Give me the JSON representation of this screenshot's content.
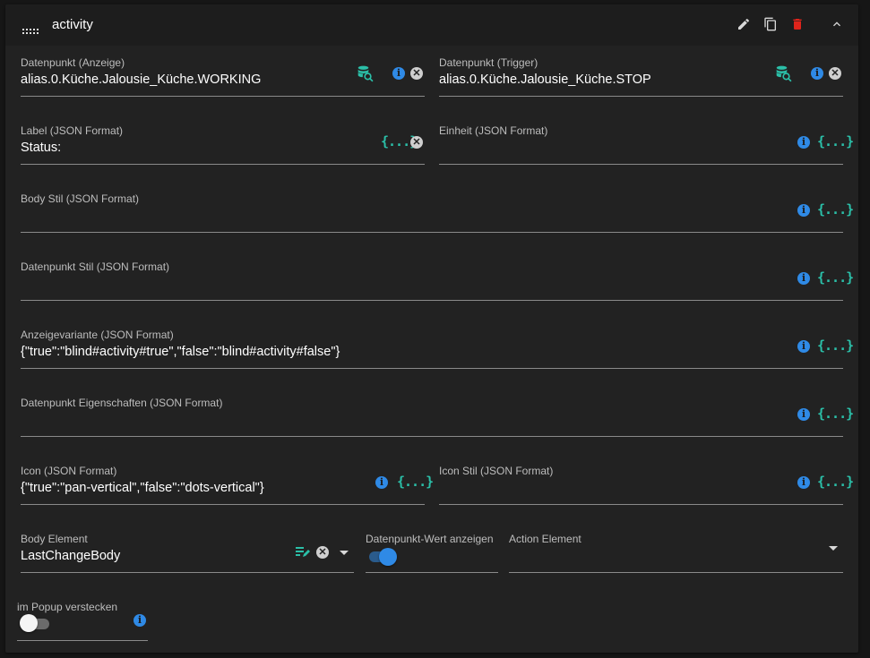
{
  "header": {
    "title": "activity",
    "icons": [
      "drag-handle-icon",
      "edit-icon",
      "copy-icon",
      "delete-icon",
      "collapse-icon"
    ]
  },
  "fields": {
    "dp_display": {
      "label": "Datenpunkt (Anzeige)",
      "value": "alias.0.Küche.Jalousie_Küche.WORKING"
    },
    "dp_trigger": {
      "label": "Datenpunkt (Trigger)",
      "value": "alias.0.Küche.Jalousie_Küche.STOP"
    },
    "label_json": {
      "label": "Label (JSON Format)",
      "value": "Status:"
    },
    "unit_json": {
      "label": "Einheit (JSON Format)",
      "value": ""
    },
    "body_style": {
      "label": "Body Stil (JSON Format)",
      "value": ""
    },
    "dp_style": {
      "label": "Datenpunkt Stil (JSON Format)",
      "value": ""
    },
    "display_variant": {
      "label": "Anzeigevariante (JSON Format)",
      "value": "{\"true\":\"blind#activity#true\",\"false\":\"blind#activity#false\"}"
    },
    "dp_properties": {
      "label": "Datenpunkt Eigenschaften (JSON Format)",
      "value": ""
    },
    "icon_json": {
      "label": "Icon (JSON Format)",
      "value": "{\"true\":\"pan-vertical\",\"false\":\"dots-vertical\"}"
    },
    "icon_style": {
      "label": "Icon Stil (JSON Format)",
      "value": ""
    },
    "body_element": {
      "label": "Body Element",
      "value": "LastChangeBody"
    },
    "show_dp_value": {
      "label": "Datenpunkt-Wert anzeigen",
      "checked": true
    },
    "action_element": {
      "label": "Action Element",
      "value": ""
    },
    "hide_in_popup": {
      "label": "im Popup verstecken",
      "checked": false
    }
  },
  "icons": {
    "json": "{...}",
    "info": "i",
    "clear": "✕"
  },
  "colors": {
    "accent": "#2f8ae6",
    "json_icon": "#2bbfa8",
    "delete": "#e0241b"
  }
}
